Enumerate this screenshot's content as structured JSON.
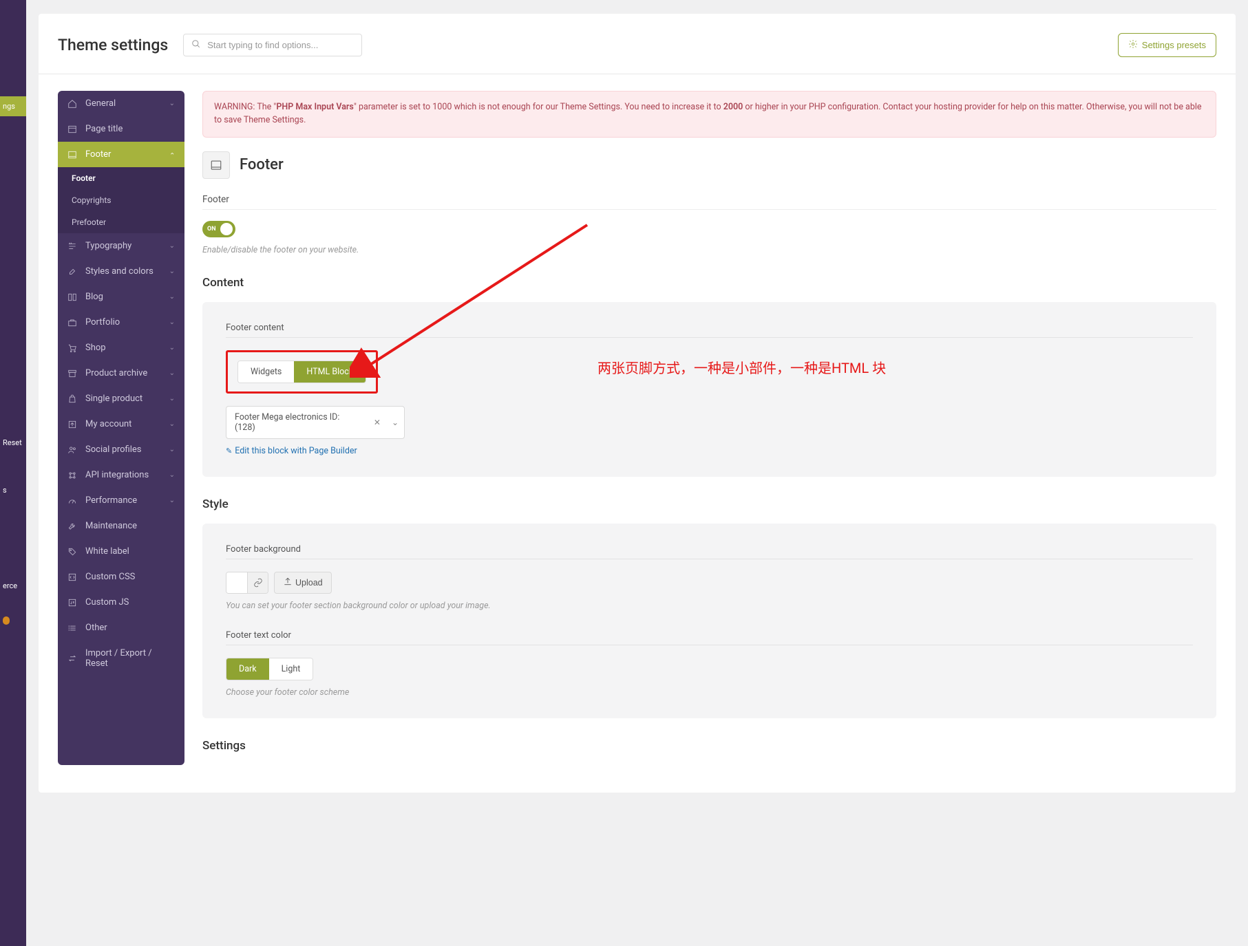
{
  "page_title": "Theme settings",
  "search": {
    "placeholder": "Start typing to find options..."
  },
  "presets_button": "Settings presets",
  "wp_sidebar": {
    "active_label": "ngs",
    "items": [
      "Reset",
      "s",
      "erce"
    ]
  },
  "side_nav": [
    {
      "label": "General",
      "icon": "home",
      "expandable": true
    },
    {
      "label": "Page title",
      "icon": "layout",
      "expandable": false
    },
    {
      "label": "Footer",
      "icon": "footer",
      "expandable": true,
      "active": true,
      "sub": [
        {
          "label": "Footer",
          "current": true
        },
        {
          "label": "Copyrights"
        },
        {
          "label": "Prefooter"
        }
      ]
    },
    {
      "label": "Typography",
      "icon": "text",
      "expandable": true
    },
    {
      "label": "Styles and colors",
      "icon": "brush",
      "expandable": true
    },
    {
      "label": "Blog",
      "icon": "columns",
      "expandable": true
    },
    {
      "label": "Portfolio",
      "icon": "briefcase",
      "expandable": true
    },
    {
      "label": "Shop",
      "icon": "cart",
      "expandable": true
    },
    {
      "label": "Product archive",
      "icon": "archive",
      "expandable": true
    },
    {
      "label": "Single product",
      "icon": "bag",
      "expandable": true
    },
    {
      "label": "My account",
      "icon": "export",
      "expandable": true
    },
    {
      "label": "Social profiles",
      "icon": "users",
      "expandable": true
    },
    {
      "label": "API integrations",
      "icon": "api",
      "expandable": true
    },
    {
      "label": "Performance",
      "icon": "gauge",
      "expandable": true
    },
    {
      "label": "Maintenance",
      "icon": "wrench",
      "expandable": false
    },
    {
      "label": "White label",
      "icon": "tag",
      "expandable": false
    },
    {
      "label": "Custom CSS",
      "icon": "css",
      "expandable": false
    },
    {
      "label": "Custom JS",
      "icon": "js",
      "expandable": false
    },
    {
      "label": "Other",
      "icon": "list",
      "expandable": false
    },
    {
      "label": "Import / Export / Reset",
      "icon": "transfer",
      "expandable": false
    }
  ],
  "warning": {
    "prefix": "WARNING: The \"",
    "bold1": "PHP Max Input Vars",
    "mid": "\" parameter is set to 1000 which is not enough for our Theme Settings. You need to increase it to ",
    "bold2": "2000",
    "suffix": " or higher in your PHP configuration. Contact your hosting provider for help on this matter. Otherwise, you will not be able to save Theme Settings."
  },
  "section": {
    "title": "Footer",
    "footer_label": "Footer",
    "toggle_on": "ON",
    "footer_help": "Enable/disable the footer on your website.",
    "content_title": "Content",
    "footer_content_label": "Footer content",
    "widgets_label": "Widgets",
    "html_block_label": "HTML Block",
    "select_value": "Footer Mega electronics ID:(128)",
    "edit_link": "Edit this block with Page Builder",
    "style_title": "Style",
    "bg_label": "Footer background",
    "upload_label": "Upload",
    "bg_help": "You can set your footer section background color or upload your image.",
    "text_color_label": "Footer text color",
    "dark_label": "Dark",
    "light_label": "Light",
    "color_help": "Choose your footer color scheme",
    "settings_title": "Settings"
  },
  "annotation": "两张页脚方式，一种是小部件，一种是HTML 块"
}
